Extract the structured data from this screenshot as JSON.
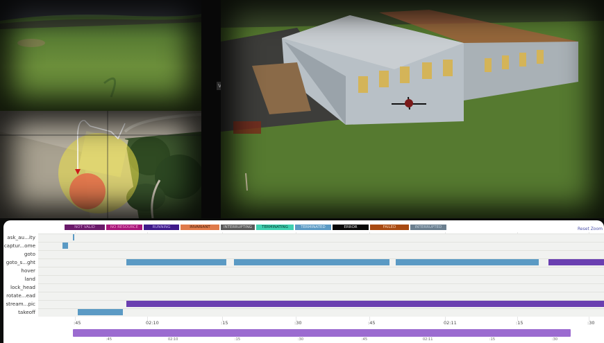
{
  "legend": [
    {
      "label": "NOT VALID",
      "color": "#6a1a6a",
      "text": "#d8a0d8"
    },
    {
      "label": "NO RESOURCE",
      "color": "#a8167a",
      "text": "#f0a0d0"
    },
    {
      "label": "RUNNING",
      "color": "#3f1a8a",
      "text": "#c0b0f0"
    },
    {
      "label": "INVARIANT",
      "color": "#e07a4a",
      "text": "#402010"
    },
    {
      "label": "INTERRUPTING",
      "color": "#5a5a5a",
      "text": "#d8d8d8"
    },
    {
      "label": "TERMINATING",
      "color": "#3fd0b0",
      "text": "#0a3a30"
    },
    {
      "label": "TERMINATED",
      "color": "#5b9ac4",
      "text": "#dfeef8"
    },
    {
      "label": "ERROR",
      "color": "#080808",
      "text": "#e0e0e0"
    },
    {
      "label": "FAILED",
      "color": "#a84a12",
      "text": "#f8d0b0"
    },
    {
      "label": "INTERRUPTED",
      "color": "#6b7f8f",
      "text": "#c0d0dc"
    }
  ],
  "reset_zoom": "Reset Zoom",
  "rows": [
    {
      "label": "ask_au...ity"
    },
    {
      "label": "captur...ome"
    },
    {
      "label": "goto"
    },
    {
      "label": "goto_s...ght"
    },
    {
      "label": "hover"
    },
    {
      "label": "land"
    },
    {
      "label": "lock_head"
    },
    {
      "label": "rotate...ead"
    },
    {
      "label": "stream...pic"
    },
    {
      "label": "takeoff"
    }
  ],
  "ticks": [
    ":45",
    "02:10",
    ":15",
    ":30",
    ":45",
    "02:11",
    ":15",
    ":30"
  ],
  "mini_ticks": [
    ":45",
    "02:10",
    ":15",
    ":30",
    ":45",
    "02:11",
    ":15",
    ":30"
  ],
  "colors": {
    "terminated": "#5b9ac4",
    "running": "#6a3fb0",
    "scroll": "#9b6bd0"
  },
  "video_tag": "V"
}
